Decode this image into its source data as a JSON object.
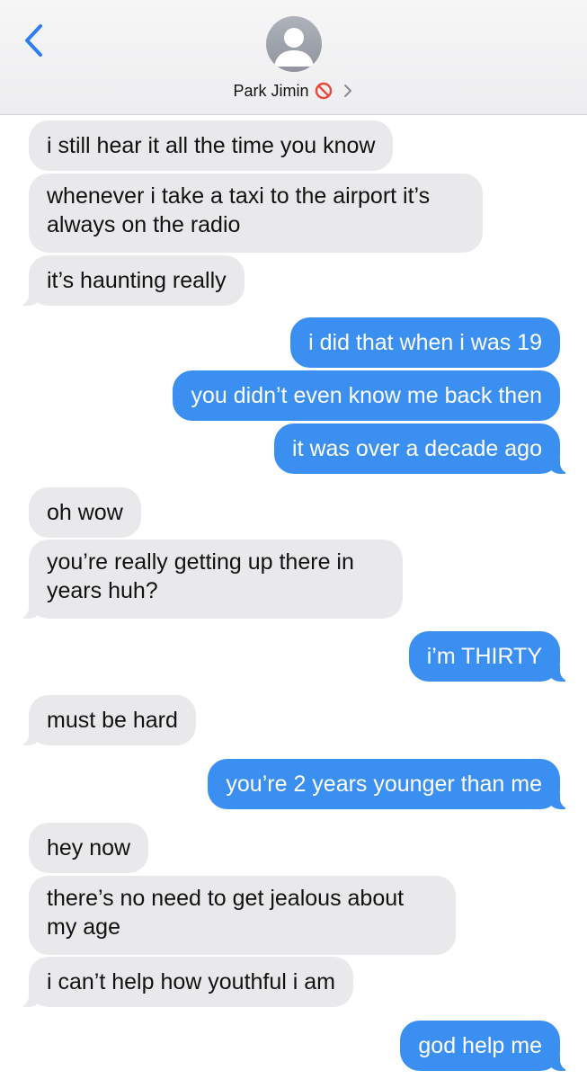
{
  "header": {
    "back_icon": "chevron-left-icon",
    "avatar_icon": "person-silhouette-icon",
    "contact_name": "Park Jimin",
    "status_icon": "blocked-icon",
    "chevron_icon": "chevron-right-icon"
  },
  "colors": {
    "incoming_bubble": "#e9e9eb",
    "outgoing_bubble": "#3b8ff0",
    "accent": "#2f7cf6",
    "blocked": "#e5483c"
  },
  "messages": [
    {
      "direction": "incoming",
      "lines": [
        "i still hear it all the time you know"
      ]
    },
    {
      "direction": "incoming",
      "lines": [
        "whenever i take a taxi to the airport it’s",
        "always on the radio"
      ]
    },
    {
      "direction": "incoming",
      "lines": [
        "it’s haunting really"
      ]
    },
    {
      "direction": "outgoing",
      "lines": [
        "i did that when i was 19"
      ]
    },
    {
      "direction": "outgoing",
      "lines": [
        "you didn’t even know me back then"
      ]
    },
    {
      "direction": "outgoing",
      "lines": [
        "it was over a decade ago"
      ]
    },
    {
      "direction": "incoming",
      "lines": [
        "oh wow"
      ]
    },
    {
      "direction": "incoming",
      "lines": [
        "you’re really getting up there in",
        "years huh?"
      ]
    },
    {
      "direction": "outgoing",
      "lines": [
        "i’m THIRTY"
      ]
    },
    {
      "direction": "incoming",
      "lines": [
        "must be hard"
      ]
    },
    {
      "direction": "outgoing",
      "lines": [
        "you’re 2 years younger than me"
      ]
    },
    {
      "direction": "incoming",
      "lines": [
        "hey now"
      ]
    },
    {
      "direction": "incoming",
      "lines": [
        "there’s no need to get jealous about",
        "my age"
      ]
    },
    {
      "direction": "incoming",
      "lines": [
        "i can’t help how youthful i am"
      ]
    },
    {
      "direction": "outgoing",
      "lines": [
        "god help me"
      ]
    }
  ]
}
